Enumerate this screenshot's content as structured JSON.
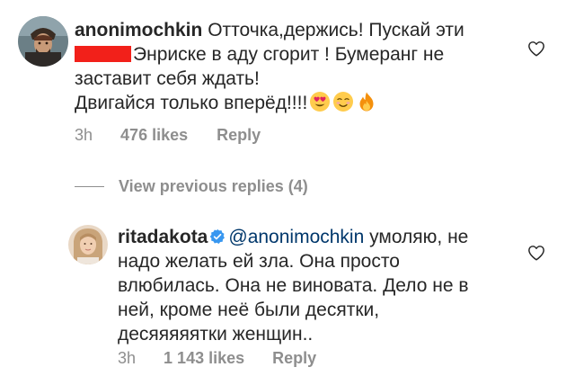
{
  "comment1": {
    "username": "anonimochkin",
    "line1_text": "Отточка,держись! Пускай эти",
    "line2_text": "Энриске в аду сгорит ! Бумеранг не",
    "line3_text": "заставит себя ждать!",
    "line4_text": "Двигайся только вперёд!!!!",
    "emojis": [
      "heart-eyes-emoji",
      "smiling-face-emoji",
      "fire-emoji"
    ],
    "time": "3h",
    "likes": "476 likes",
    "reply_label": "Reply"
  },
  "view_replies_label": "View previous replies (4)",
  "comment2": {
    "username": "ritadakota",
    "verified": true,
    "mention": "@anonimochkin",
    "line1_text": "умоляю, не",
    "line2_text": "надо желать ей зла. Она просто",
    "line3_text": "влюбилась. Она не виновата. Дело не в",
    "line4_text": "ней, кроме неё были десятки,",
    "line5_text": "десяяяяятки женщин..",
    "time": "3h",
    "likes": "1 143 likes",
    "reply_label": "Reply"
  },
  "colors": {
    "text": "#262626",
    "secondary": "#8e8e8e",
    "mention": "#00376b",
    "verified": "#3897f0",
    "redaction": "#f2201a"
  }
}
